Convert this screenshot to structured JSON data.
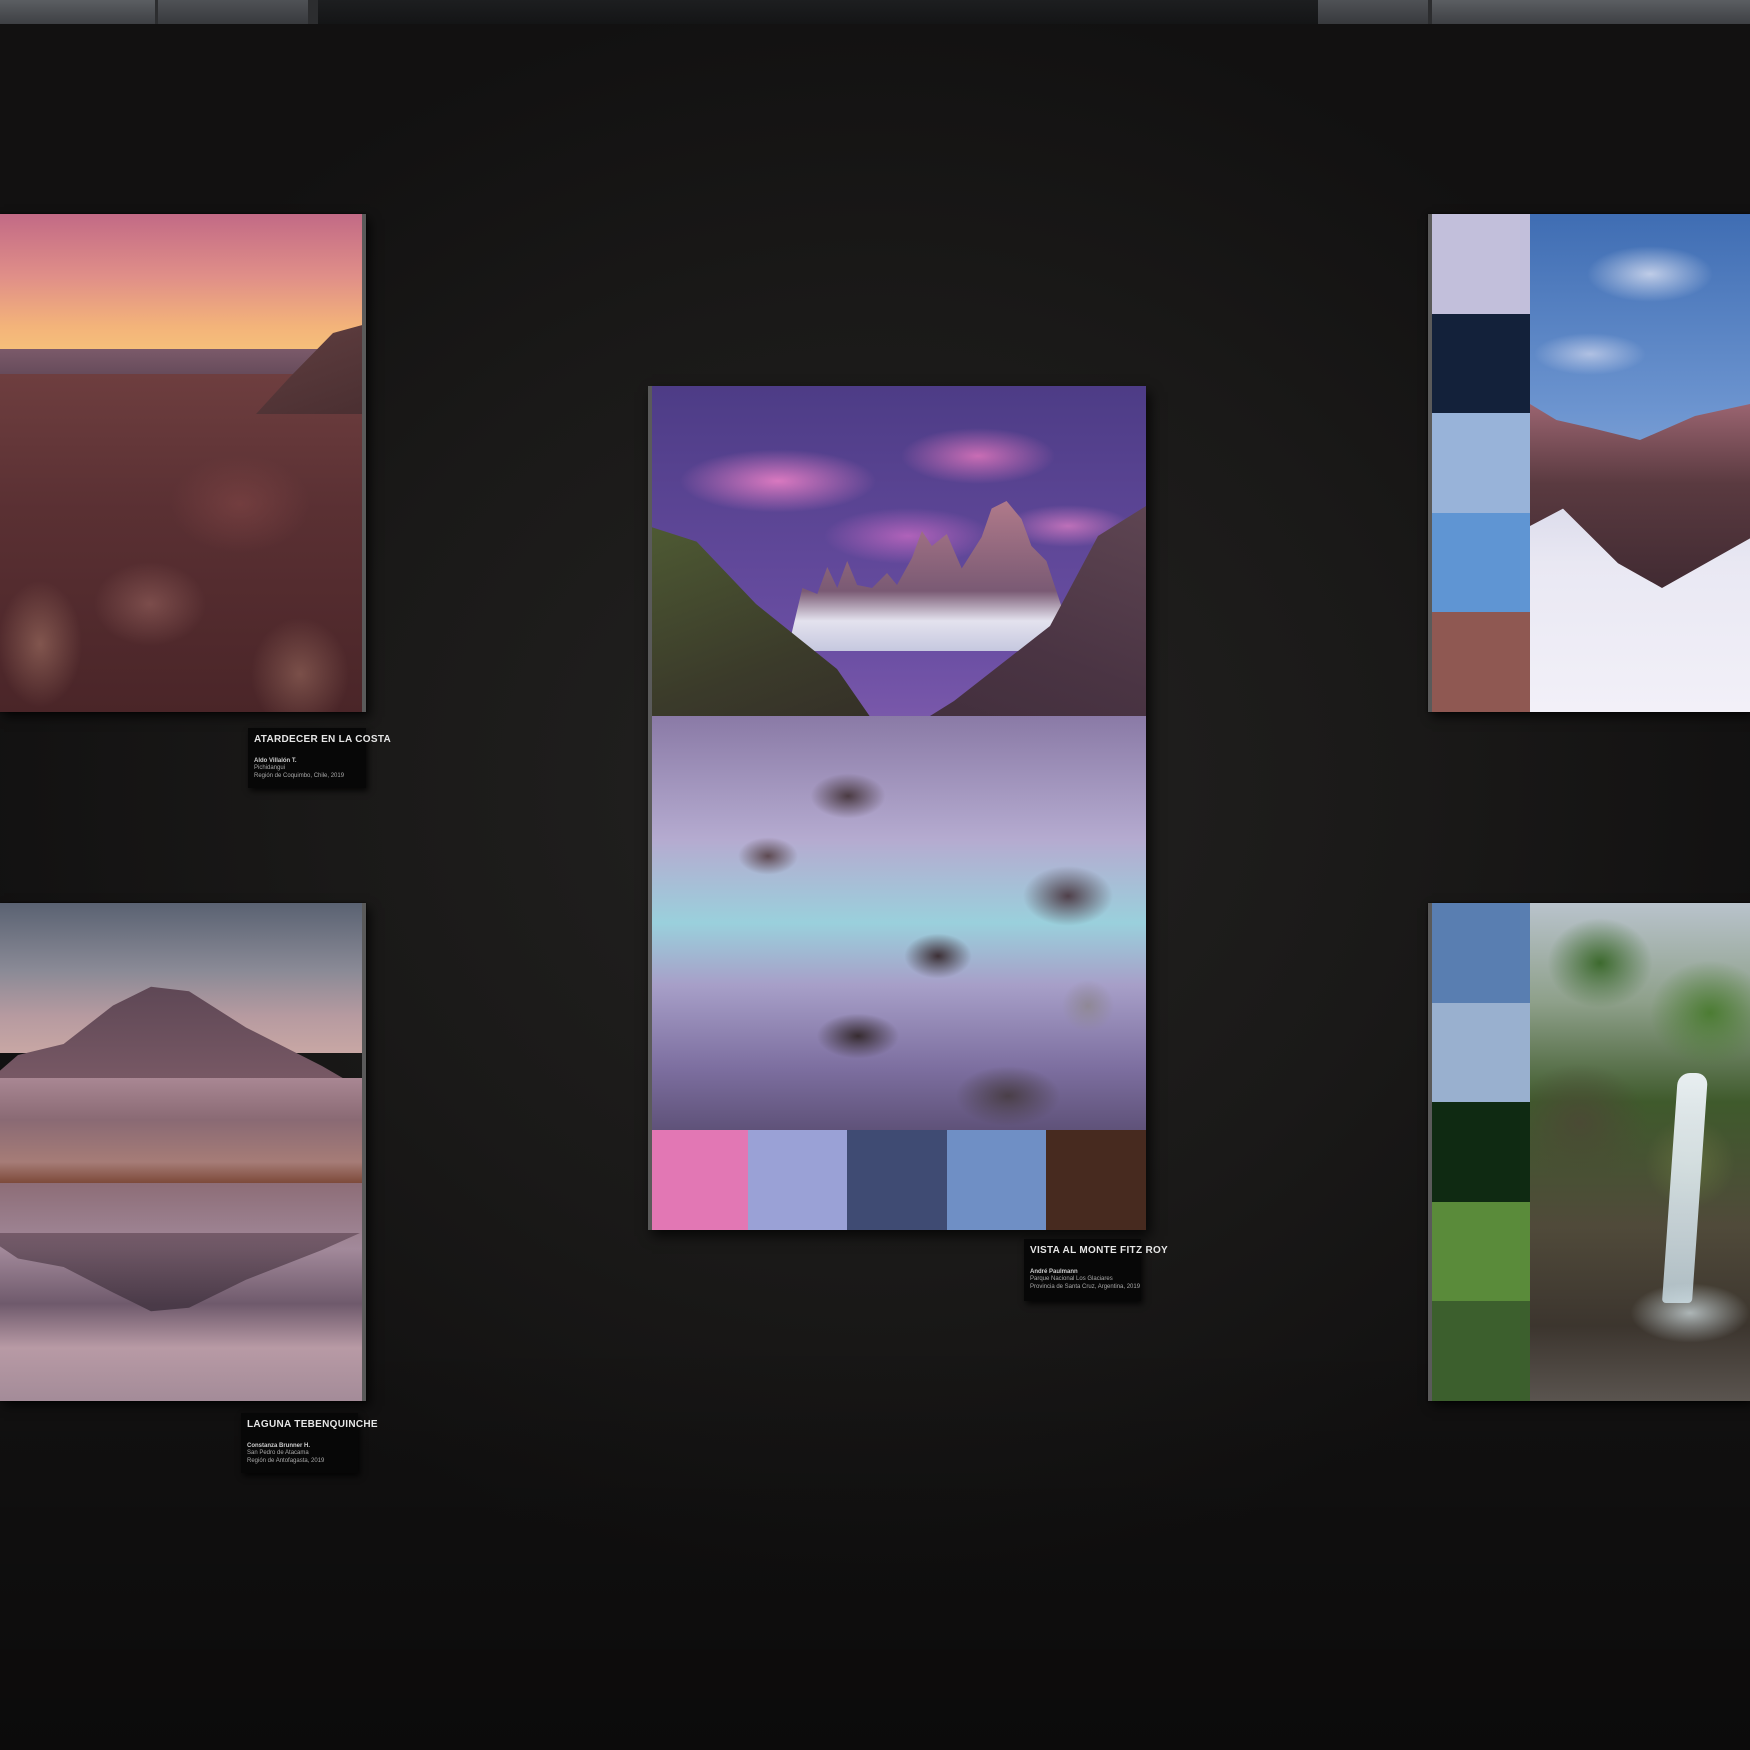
{
  "artworks": [
    {
      "id": "atardecer",
      "title": "ATARDECER EN LA COSTA",
      "author": "Aldo Villalón T.",
      "location_lines": [
        "Pichidangui",
        "Región de Coquimbo, Chile, 2019"
      ]
    },
    {
      "id": "laguna",
      "title": "LAGUNA TEBENQUINCHE",
      "author": "Constanza Brunner H.",
      "location_lines": [
        "San Pedro de Atacama",
        "Región de Antofagasta, 2019"
      ]
    },
    {
      "id": "fitzroy",
      "title": "VISTA AL MONTE FITZ ROY",
      "author": "André Paulmann",
      "location_lines": [
        "Parque Nacional Los Glaciares",
        "Provincia de Santa Cruz, Argentina, 2019"
      ],
      "palette": [
        "#e277b4",
        "#9aa1d6",
        "#3f4b73",
        "#6f8fc5",
        "#472a1f"
      ]
    },
    {
      "id": "mountains",
      "palette": [
        "#c2bfdb",
        "#13213a",
        "#98b3d9",
        "#5f95d3",
        "#8f5852"
      ]
    },
    {
      "id": "waterfall",
      "palette": [
        "#597eb1",
        "#99b0cf",
        "#0f2a12",
        "#5a8b3a",
        "#3c5f2d"
      ]
    }
  ]
}
